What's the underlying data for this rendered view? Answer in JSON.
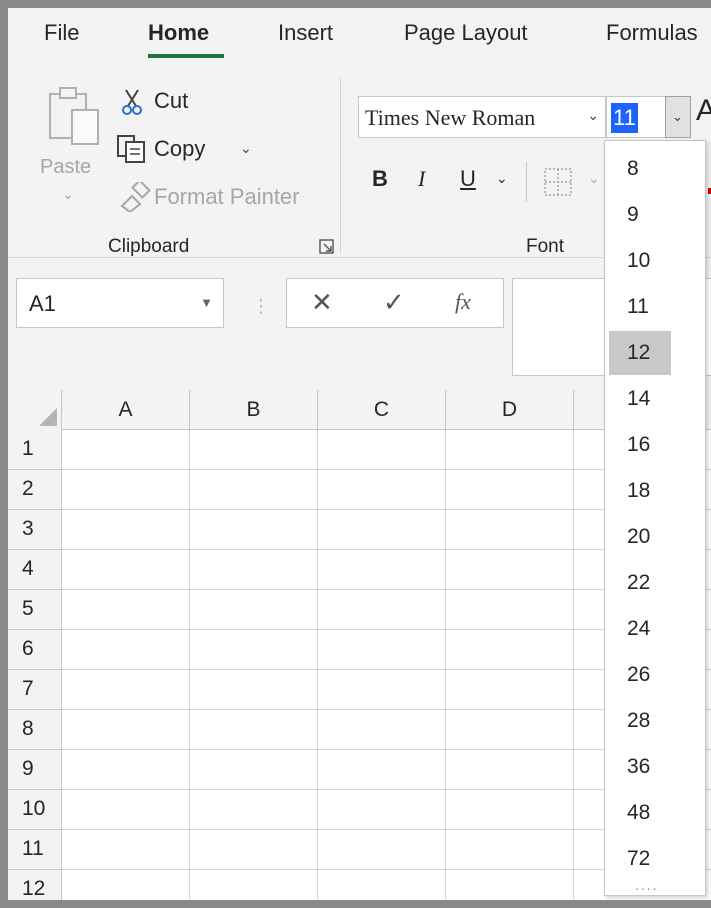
{
  "ribbon_tabs": [
    "File",
    "Home",
    "Insert",
    "Page Layout",
    "Formulas"
  ],
  "active_tab": "Home",
  "clipboard": {
    "paste_label": "Paste",
    "cut_label": "Cut",
    "copy_label": "Copy",
    "format_painter_label": "Format Painter",
    "group_label": "Clipboard"
  },
  "font": {
    "font_name": "Times New Roman",
    "font_size": "11",
    "group_label": "Font",
    "bold_label": "B",
    "italic_label": "I",
    "underline_label": "U",
    "grow_font_label": "A"
  },
  "formula_bar": {
    "name_box_value": "A1",
    "cancel_symbol": "✕",
    "enter_symbol": "✓",
    "function_symbol": "fx"
  },
  "columns": [
    "A",
    "B",
    "C",
    "D"
  ],
  "rows": [
    "1",
    "2",
    "3",
    "4",
    "5",
    "6",
    "7",
    "8",
    "9",
    "10",
    "11",
    "12"
  ],
  "font_size_dropdown": {
    "options": [
      "8",
      "9",
      "10",
      "11",
      "12",
      "14",
      "16",
      "18",
      "20",
      "22",
      "24",
      "26",
      "28",
      "36",
      "48",
      "72"
    ],
    "highlighted": "12"
  },
  "colors": {
    "accent_green": "#217346",
    "selection_blue": "#1e62ff",
    "highlight_gray": "#c8c8c8"
  },
  "icons": [
    "paste-icon",
    "cut-icon",
    "copy-icon",
    "format-painter-icon",
    "borders-icon",
    "dialog-launcher-icon",
    "select-all-icon"
  ]
}
